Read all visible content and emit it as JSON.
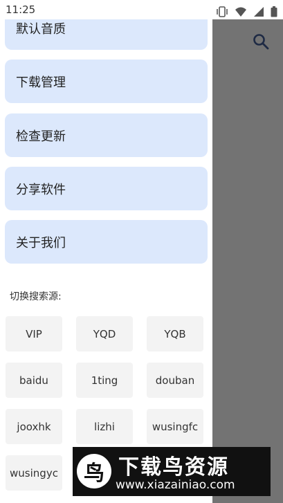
{
  "status_bar": {
    "time": "11:25"
  },
  "menu": [
    {
      "label": "默认音质"
    },
    {
      "label": "下载管理"
    },
    {
      "label": "检查更新"
    },
    {
      "label": "分享软件"
    },
    {
      "label": "关于我们"
    }
  ],
  "source_section": {
    "label": "切换搜索源:",
    "sources": [
      "VIP",
      "YQD",
      "YQB",
      "baidu",
      "1ting",
      "douban",
      "jooxhk",
      "lizhi",
      "wusingfc",
      "wusingyc"
    ]
  },
  "watermark": {
    "logo_char": "鸟",
    "title": "下载鸟资源",
    "url": "www.xiazainiao.com"
  },
  "colors": {
    "card": "#dce8fc",
    "scrim": "#737373",
    "source_button": "#f3f3f3"
  },
  "icons": [
    "vibrate-icon",
    "wifi-icon",
    "cellular-icon",
    "battery-icon",
    "search-icon"
  ]
}
